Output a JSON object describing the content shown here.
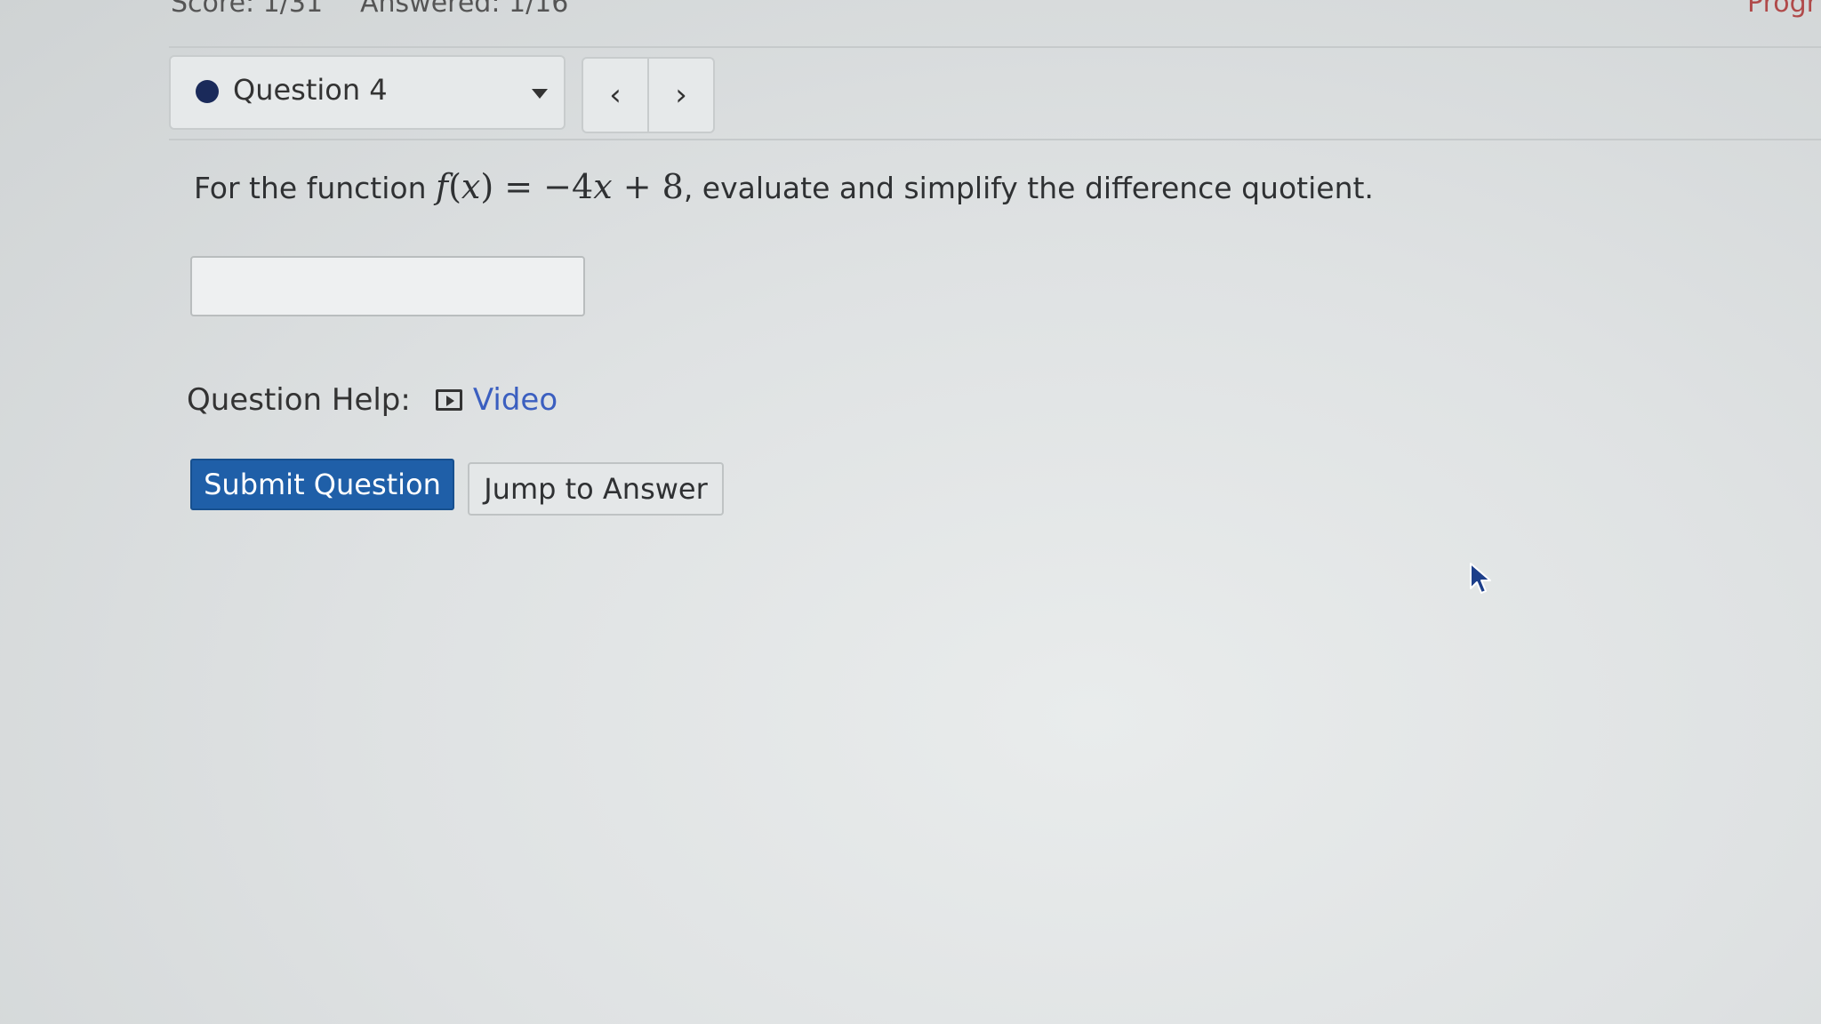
{
  "header": {
    "score": "Score: 1/31",
    "answered": "Answered: 1/16",
    "progress": "Progr"
  },
  "question_selector": {
    "label": "Question 4"
  },
  "navigation": {
    "prev_label": "‹",
    "next_label": "›"
  },
  "question": {
    "prefix": "For the function ",
    "suffix": ", evaluate and simplify the difference quotient."
  },
  "answer": {
    "value": "",
    "placeholder": ""
  },
  "help": {
    "label": "Question Help:",
    "video_label": "Video"
  },
  "buttons": {
    "submit": "Submit Question",
    "jump": "Jump to Answer"
  },
  "colors": {
    "submit_bg": "#1f5fa8",
    "link": "#3b5fc0",
    "question_dot": "#1a2a5a"
  },
  "icons": {
    "question_status": "filled-circle",
    "dropdown": "caret-down-icon",
    "prev": "chevron-left-icon",
    "next": "chevron-right-icon",
    "video": "video-play-icon",
    "cursor": "mouse-pointer-icon"
  }
}
